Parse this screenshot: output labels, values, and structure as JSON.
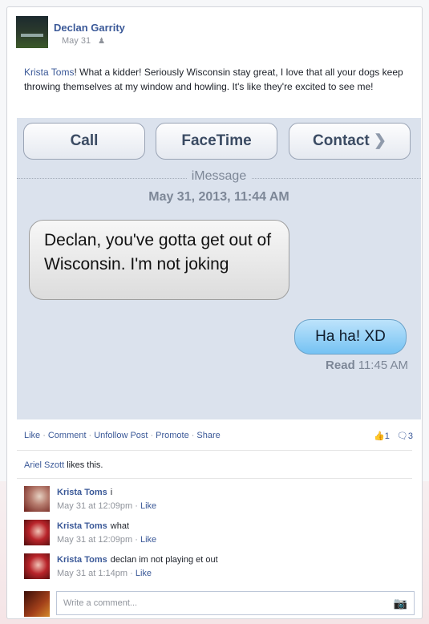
{
  "post": {
    "author": "Declan Garrity",
    "date": "May 31",
    "audience_icon": "friends-icon",
    "mention": "Krista Toms",
    "text": "! What a kidder! Seriously Wisconsin stay great, I love that all your dogs keep throwing themselves at my window and howling. It's like they're excited to see me!"
  },
  "imessage": {
    "buttons": [
      "Call",
      "FaceTime",
      "Contact"
    ],
    "label": "iMessage",
    "date": "May 31, 2013, 11:44 AM",
    "incoming": "Declan, you've gotta get out of Wisconsin.  I'm not joking",
    "outgoing": "Ha ha! XD",
    "read_label": "Read",
    "read_time": "11:45 AM"
  },
  "actions": {
    "items": [
      "Like",
      "Comment",
      "Unfollow Post",
      "Promote",
      "Share"
    ],
    "like_count": "1",
    "comment_count": "3"
  },
  "likes": {
    "name": "Ariel Szott",
    "suffix": " likes this."
  },
  "comments": [
    {
      "name": "Krista Toms",
      "text": "i",
      "time": "May 31 at 12:09pm",
      "like": "Like"
    },
    {
      "name": "Krista Toms",
      "text": "what",
      "time": "May 31 at 12:09pm",
      "like": "Like"
    },
    {
      "name": "Krista Toms",
      "text": "declan im not playing et out",
      "time": "May 31 at 1:14pm",
      "like": "Like"
    }
  ],
  "composer": {
    "placeholder": "Write a comment..."
  }
}
